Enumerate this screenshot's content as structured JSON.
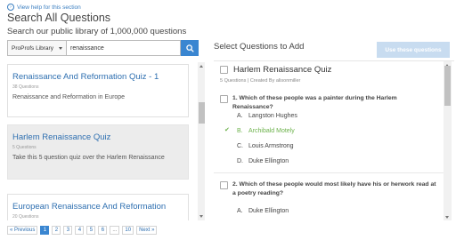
{
  "help": {
    "label": "View help for this section"
  },
  "page": {
    "title": "Search All Questions",
    "subtitle": "Search our public library of 1,000,000 questions"
  },
  "search": {
    "library": "ProProfs Library",
    "query": "renaissance"
  },
  "results": [
    {
      "title": "Renaissance And Reformation Quiz - 1",
      "count": "38 Questions",
      "desc": "Renaissance and Reformation in Europe"
    },
    {
      "title": "Harlem Renaissance Quiz",
      "count": "5 Questions",
      "desc": "Take this 5 question quiz over the Harlem Renaissance"
    },
    {
      "title": "European Renaissance And Reformation",
      "count": "20 Questions",
      "desc": ""
    }
  ],
  "pagination": {
    "prev": "« Previous",
    "pages": [
      "1",
      "2",
      "3",
      "4",
      "5",
      "6"
    ],
    "ellipsis": "...",
    "last": "10",
    "next": "Next »",
    "current": "1"
  },
  "right": {
    "title": "Select Questions to Add",
    "use_button": "Use these questions"
  },
  "quiz": {
    "name": "Harlem Renaissance Quiz",
    "meta": "5 Questions | Created By alisonmiller",
    "questions": [
      {
        "text": "1. Which of these people was a painter during the Harlem Renaissance?",
        "answers": [
          {
            "letter": "A.",
            "text": "Langston Hughes",
            "correct": false
          },
          {
            "letter": "B.",
            "text": "Archibald Motely",
            "correct": true
          },
          {
            "letter": "C.",
            "text": "Louis Armstrong",
            "correct": false
          },
          {
            "letter": "D.",
            "text": "Duke Ellington",
            "correct": false
          }
        ]
      },
      {
        "text": "2. Which of these people would most likely have his or herwork read at a poetry reading?",
        "answers": [
          {
            "letter": "A.",
            "text": "Duke Ellington",
            "correct": false
          }
        ]
      }
    ]
  },
  "colors": {
    "link": "#2e6fb0",
    "primary": "#3a86d1",
    "correct": "#6db24c",
    "disabled_button": "#c8dcf0"
  }
}
